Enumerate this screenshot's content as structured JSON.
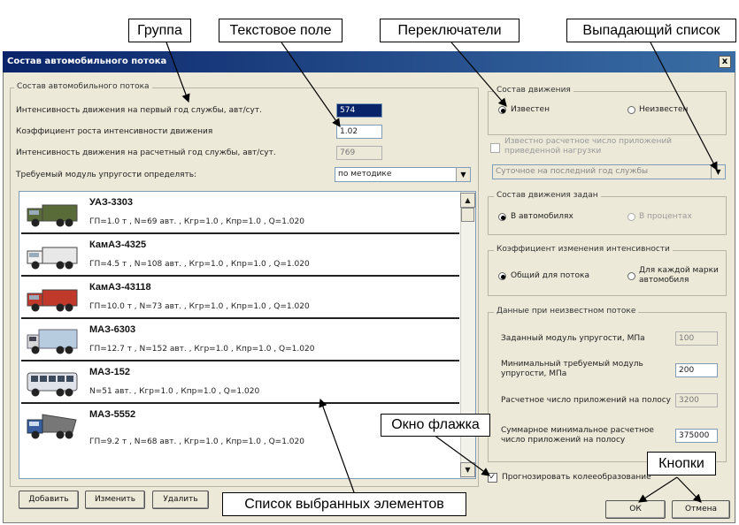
{
  "window": {
    "title": "Состав автомобильного потока",
    "close_label": "x"
  },
  "left_group": {
    "legend": "Состав автомобильного потока",
    "rows": [
      {
        "label": "Интенсивность движения на первый год службы, авт/сут.",
        "value": "574"
      },
      {
        "label": "Коэффициент роста интенсивности движения",
        "value": "1.02"
      },
      {
        "label": "Интенсивность движения на расчетный год службы, авт/сут.",
        "value": "769"
      }
    ],
    "modulus_label": "Требуемый модуль упругости определять:",
    "modulus_select": "по методике"
  },
  "vehicles": [
    {
      "name": "УАЗ-3303",
      "params": "ГП=1.0 т , N=69 авт. , Кгр=1.0 , Кпр=1.0 , Q=1.020",
      "kind": "truck",
      "color": "#5a6b3a"
    },
    {
      "name": "КамАЗ-4325",
      "params": "ГП=4.5 т , N=108 авт. , Кгр=1.0 , Кпр=1.0 , Q=1.020",
      "kind": "truck",
      "color": "#e8e8e8"
    },
    {
      "name": "КамАЗ-43118",
      "params": "ГП=10.0 т , N=73 авт. , Кгр=1.0 , Кпр=1.0 , Q=1.020",
      "kind": "truck",
      "color": "#c0392b"
    },
    {
      "name": "МАЗ-6303",
      "params": "ГП=12.7 т , N=152 авт. , Кгр=1.0 , Кпр=1.0 , Q=1.020",
      "kind": "van",
      "color": "#b8cce0"
    },
    {
      "name": "МАЗ-152",
      "params": "N=51 авт. , Кгр=1.0 , Кпр=1.0 , Q=1.020",
      "kind": "bus",
      "color": "#e0e4ea"
    },
    {
      "name": "МАЗ-5552",
      "params": "ГП=9.2 т , N=68 авт. , Кгр=1.0 , Кпр=1.0 , Q=1.020",
      "kind": "dump",
      "color": "#3a5fa0"
    }
  ],
  "buttons": {
    "add": "Добавить",
    "edit": "Изменить",
    "delete": "Удалить",
    "ok": "ОК",
    "cancel": "Отмена"
  },
  "traffic_group": {
    "legend": "Состав движения",
    "known": "Известен",
    "unknown": "Неизвестен"
  },
  "known_loads": {
    "label": "Известно расчетное число приложений приведенной нагрузки",
    "select": "Суточное на последний год службы"
  },
  "composition_group": {
    "legend": "Состав движения задан",
    "in_vehicles": "В автомобилях",
    "in_percent": "В процентах"
  },
  "coef_group": {
    "legend": "Коэффициент изменения интенсивности",
    "common": "Общий для потока",
    "per_brand": "Для каждой марки автомобиля"
  },
  "unknown_group": {
    "legend": "Данные при неизвестном потоке",
    "rows": [
      {
        "label": "Заданный модуль упругости, МПа",
        "value": "100"
      },
      {
        "label": "Минимальный требуемый модуль упругости, МПа",
        "value": "200"
      },
      {
        "label": "Расчетное число приложений на полосу",
        "value": "3200"
      },
      {
        "label": "Суммарное минимальное расчетное число приложений на полосу",
        "value": "375000"
      }
    ]
  },
  "rutting_label": "Прогнозировать колееобразование",
  "callouts": {
    "group": "Группа",
    "text_field": "Текстовое поле",
    "switches": "Переключатели",
    "dropdown": "Выпадающий список",
    "checkbox": "Окно флажка",
    "buttons": "Кнопки",
    "list": "Список выбранных элементов"
  }
}
